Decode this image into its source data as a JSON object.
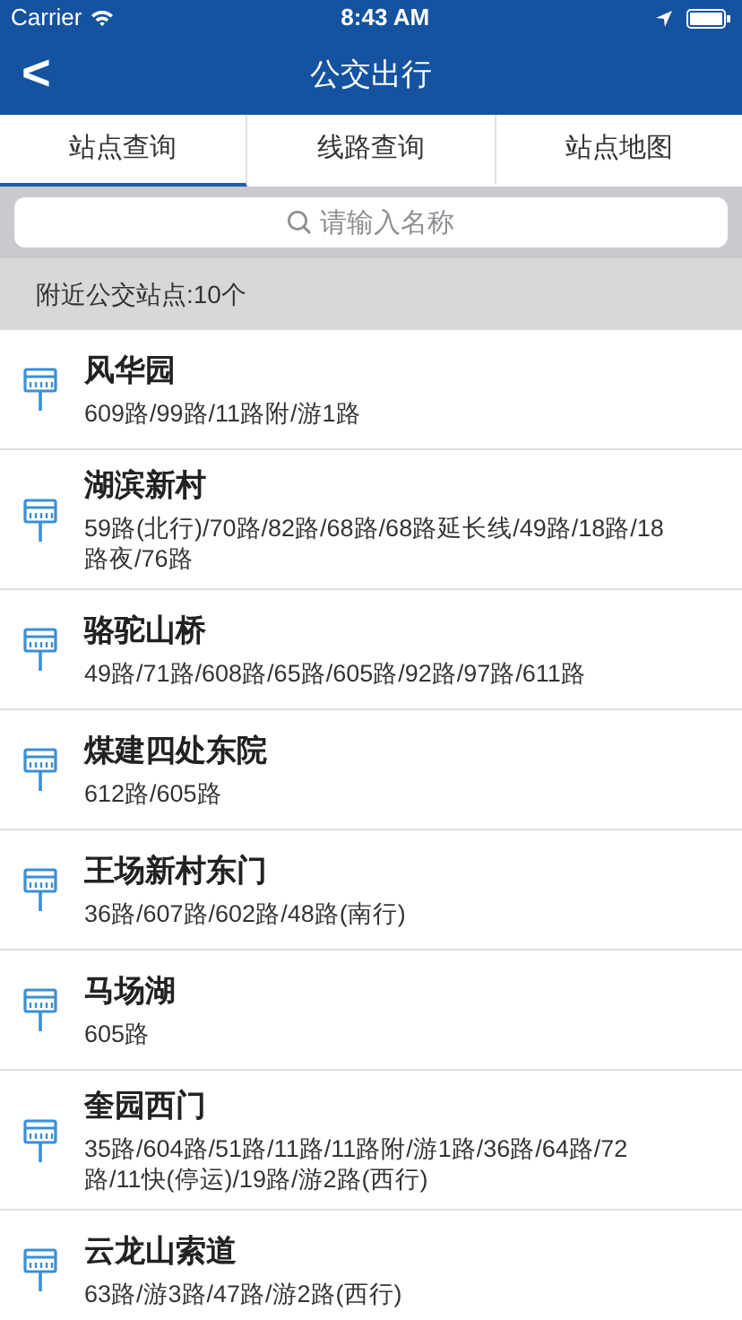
{
  "status_bar": {
    "carrier": "Carrier",
    "time": "8:43 AM"
  },
  "nav_bar": {
    "back": "<",
    "title": "公交出行"
  },
  "tabs": [
    {
      "label": "站点查询",
      "selected": true
    },
    {
      "label": "线路查询",
      "selected": false
    },
    {
      "label": "站点地图",
      "selected": false
    }
  ],
  "search": {
    "placeholder": "请输入名称"
  },
  "section_header": "附近公交站点:10个",
  "stops": [
    {
      "name": "风华园",
      "routes": "609路/99路/11路附/游1路"
    },
    {
      "name": "湖滨新村",
      "routes": "59路(北行)/70路/82路/68路/68路延长线/49路/18路/18路夜/76路"
    },
    {
      "name": "骆驼山桥",
      "routes": "49路/71路/608路/65路/605路/92路/97路/611路"
    },
    {
      "name": "煤建四处东院",
      "routes": "612路/605路"
    },
    {
      "name": "王场新村东门",
      "routes": "36路/607路/602路/48路(南行)"
    },
    {
      "name": "马场湖",
      "routes": "605路"
    },
    {
      "name": "奎园西门",
      "routes": "35路/604路/51路/11路/11路附/游1路/36路/64路/72路/11快(停运)/19路/游2路(西行)"
    },
    {
      "name": "云龙山索道",
      "routes": "63路/游3路/47路/游2路(西行)"
    }
  ]
}
